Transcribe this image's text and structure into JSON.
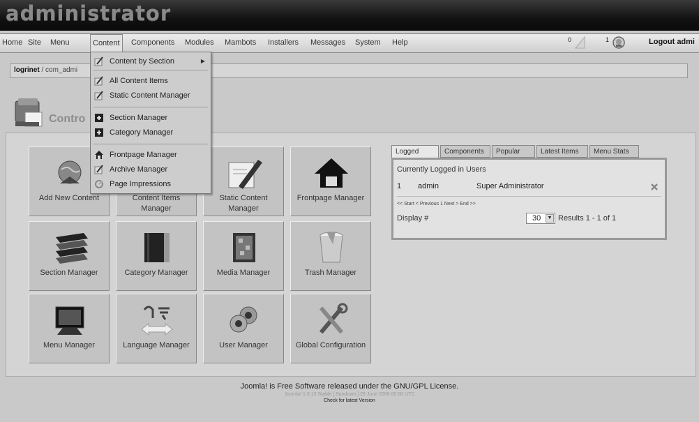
{
  "header": {
    "logo_text": "administrator"
  },
  "menubar": {
    "items": [
      "Home",
      "Site",
      "Menu",
      "Content",
      "Components",
      "Modules",
      "Mambots",
      "Installers",
      "Messages",
      "System",
      "Help"
    ],
    "messages_count": "0",
    "users_count": "1",
    "logout_label": "Logout admi"
  },
  "pathway": {
    "site": "logrinet",
    "rest": " / com_admi"
  },
  "control_panel": {
    "title": "Contro"
  },
  "dropdown": {
    "items": [
      "Content by Section",
      "All Content Items",
      "Static Content Manager",
      "Section Manager",
      "Category Manager",
      "Frontpage Manager",
      "Archive Manager",
      "Page Impressions"
    ]
  },
  "grid": [
    [
      "Add New Content",
      "Content Items",
      "Manager"
    ],
    [
      "Static Content",
      "Manager"
    ],
    [
      "Frontpage Manager"
    ],
    [
      "Section Manager"
    ],
    [
      "Category Manager"
    ],
    [
      "Media Manager"
    ],
    [
      "Trash Manager"
    ],
    [
      "Menu Manager"
    ],
    [
      "Language Manager"
    ],
    [
      "User Manager"
    ],
    [
      "Global Configuration"
    ]
  ],
  "cells": {
    "add_new_content": "Add New Content",
    "content_items_l1": "Content Items",
    "content_items_l2": "Manager",
    "static_content_l1": "Static Content",
    "static_content_l2": "Manager",
    "frontpage_manager": "Frontpage Manager",
    "section_manager": "Section Manager",
    "category_manager": "Category Manager",
    "media_manager": "Media Manager",
    "trash_manager": "Trash Manager",
    "menu_manager": "Menu Manager",
    "language_manager": "Language Manager",
    "user_manager": "User Manager",
    "global_configuration": "Global Configuration"
  },
  "stats": {
    "tabs": [
      "Logged",
      "Components",
      "Popular",
      "Latest Items",
      "Menu Stats"
    ],
    "header": "Currently Logged in Users",
    "row": {
      "num": "1",
      "user": "admin",
      "role": "Super Administrator"
    },
    "pager": "<< Start < Previous 1 Next > End >>",
    "display_label": "Display #",
    "display_value": "30",
    "results": "Results 1 - 1 of 1"
  },
  "footer": {
    "line1": "Joomla! is Free Software released under the GNU/GPL License.",
    "line2": "Joomla! 1.0.10 Stable [ Sundown ] 26 June 2006 00:00 UTC",
    "line3": "Check for latest Version"
  }
}
